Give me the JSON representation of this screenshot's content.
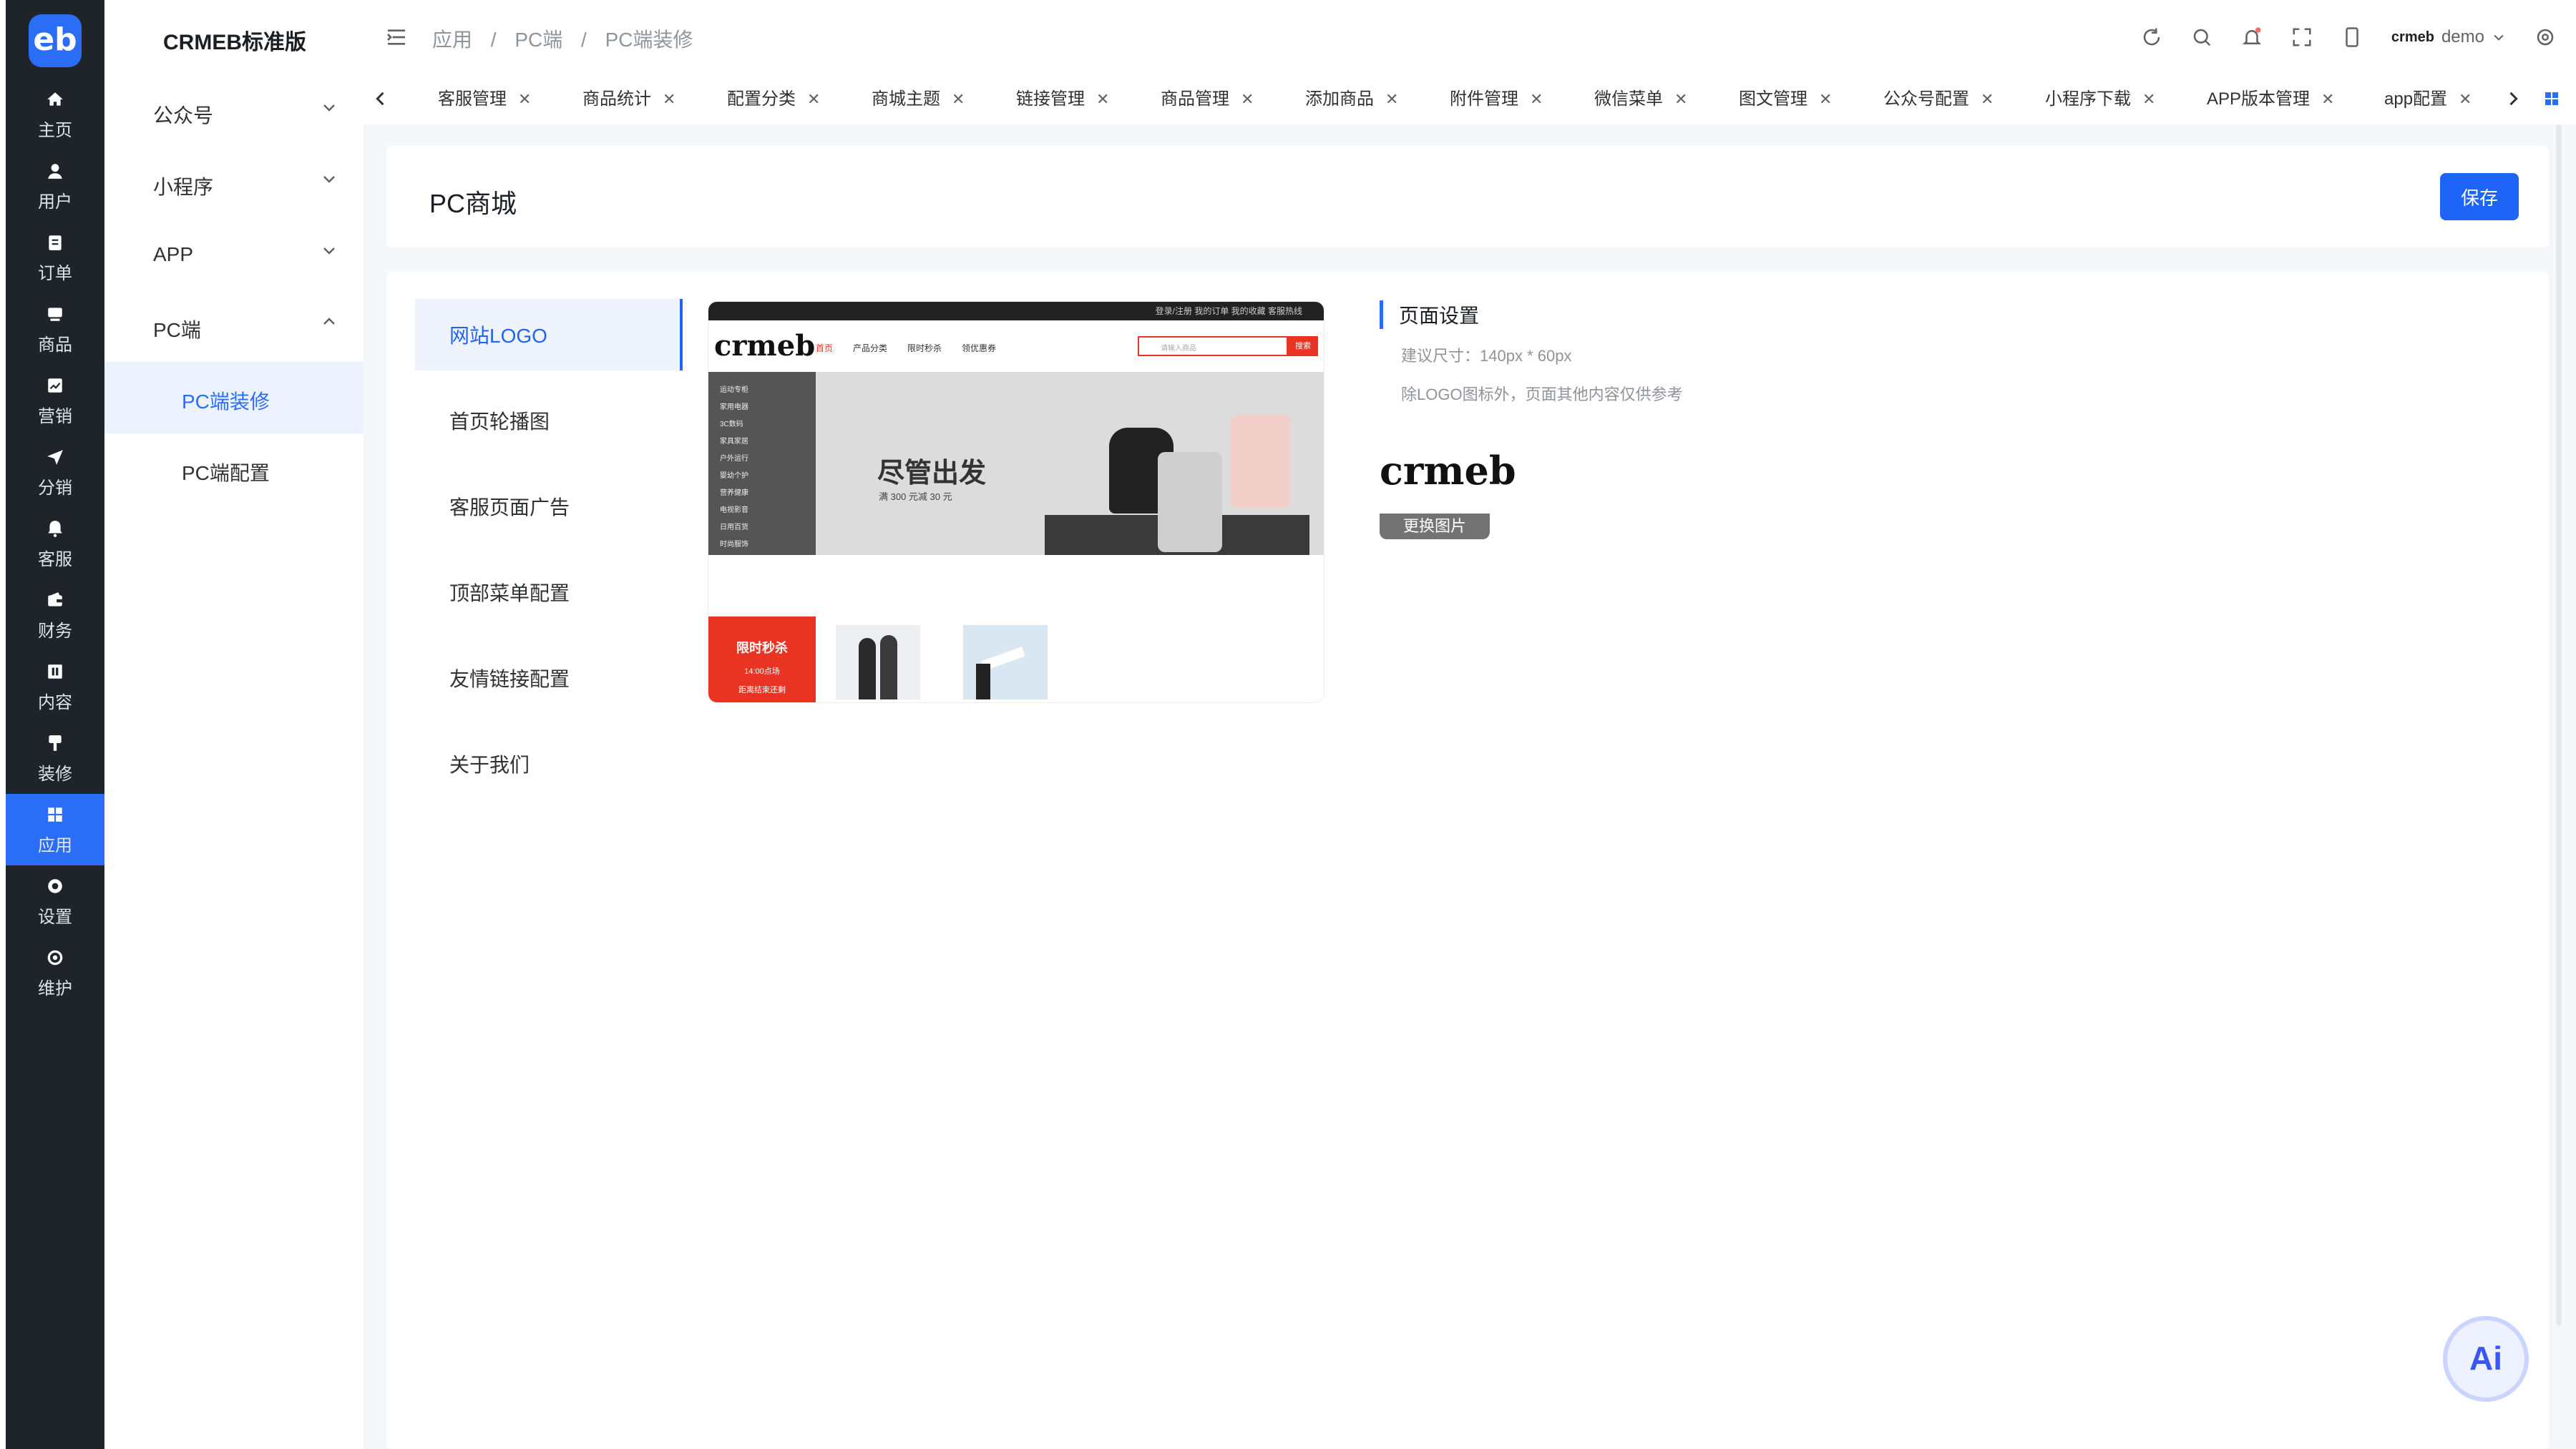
{
  "brand": {
    "logo_text": "eb",
    "app_title": "CRMEB标准版",
    "accent": "#2a6df6"
  },
  "rail": [
    {
      "label": "主页",
      "icon": "home-icon"
    },
    {
      "label": "用户",
      "icon": "user-icon"
    },
    {
      "label": "订单",
      "icon": "order-icon"
    },
    {
      "label": "商品",
      "icon": "product-icon"
    },
    {
      "label": "营销",
      "icon": "marketing-icon"
    },
    {
      "label": "分销",
      "icon": "distribution-icon"
    },
    {
      "label": "客服",
      "icon": "service-icon"
    },
    {
      "label": "财务",
      "icon": "finance-icon"
    },
    {
      "label": "内容",
      "icon": "content-icon"
    },
    {
      "label": "装修",
      "icon": "decorate-icon"
    },
    {
      "label": "应用",
      "icon": "apps-icon",
      "active": true
    },
    {
      "label": "设置",
      "icon": "settings-icon"
    },
    {
      "label": "维护",
      "icon": "maintenance-icon"
    }
  ],
  "submenu": {
    "groups": [
      {
        "label": "公众号",
        "chevron": "down"
      },
      {
        "label": "小程序",
        "chevron": "down"
      },
      {
        "label": "APP",
        "chevron": "down"
      },
      {
        "label": "PC端",
        "chevron": "up"
      }
    ],
    "subitems": [
      {
        "label": "PC端装修",
        "active": true
      },
      {
        "label": "PC端配置"
      }
    ]
  },
  "header": {
    "breadcrumb": [
      "应用",
      "/",
      "PC端",
      "/",
      "PC端装修"
    ],
    "user": "demo",
    "user_logo": "crmeb"
  },
  "tabs": [
    {
      "label": "客服管理"
    },
    {
      "label": "商品统计"
    },
    {
      "label": "配置分类"
    },
    {
      "label": "商城主题"
    },
    {
      "label": "链接管理"
    },
    {
      "label": "商品管理"
    },
    {
      "label": "添加商品"
    },
    {
      "label": "附件管理"
    },
    {
      "label": "微信菜单"
    },
    {
      "label": "图文管理"
    },
    {
      "label": "公众号配置"
    },
    {
      "label": "小程序下载"
    },
    {
      "label": "APP版本管理"
    },
    {
      "label": "app配置"
    }
  ],
  "page": {
    "title": "PC商城",
    "save_label": "保存"
  },
  "sections": [
    {
      "label": "网站LOGO",
      "active": true
    },
    {
      "label": "首页轮播图"
    },
    {
      "label": "客服页面广告"
    },
    {
      "label": "顶部菜单配置"
    },
    {
      "label": "友情链接配置"
    },
    {
      "label": "关于我们"
    }
  ],
  "preview": {
    "top_links": "登录/注册   我的订单   我的收藏   客服热线",
    "logo": "crmeb",
    "nav": [
      "首页",
      "产品分类",
      "限时秒杀",
      "领优惠券"
    ],
    "search_placeholder": "请输入商品",
    "search_btn": "搜索",
    "banner_headline": "尽管出发",
    "banner_sub": "满 300 元减 30 元",
    "categories": [
      "运动专柜",
      "家用电器",
      "3C数码",
      "家具家居",
      "户外运行",
      "婴幼个护",
      "营养健康",
      "电视影音",
      "日用百货",
      "时尚服饰"
    ],
    "flash": {
      "title": "限时秒杀",
      "time": "14:00点场",
      "sub": "距离结束还剩"
    }
  },
  "settings": {
    "title": "页面设置",
    "size_hint": "建议尺寸：140px * 60px",
    "note": "除LOGO图标外，页面其他内容仅供参考",
    "logo_text": "crmeb",
    "replace_label": "更换图片"
  },
  "ai_label": "Ai"
}
